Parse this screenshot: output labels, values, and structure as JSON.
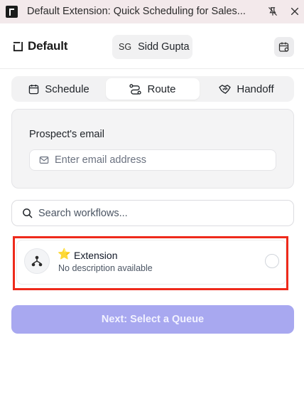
{
  "window": {
    "title": "Default Extension: Quick Scheduling for Sales...",
    "pin_icon": "pin-off-icon",
    "close_icon": "close-icon"
  },
  "header": {
    "brand_name": "Default",
    "brand_icon": "default-logo-icon",
    "user_initials": "SG",
    "user_name": "Sidd Gupta",
    "calendar_icon": "calendar-settings-icon"
  },
  "tabs": [
    {
      "label": "Schedule",
      "icon": "calendar-icon",
      "active": false
    },
    {
      "label": "Route",
      "icon": "route-icon",
      "active": true
    },
    {
      "label": "Handoff",
      "icon": "handshake-icon",
      "active": false
    }
  ],
  "email_card": {
    "label": "Prospect's email",
    "placeholder": "Enter email address",
    "value": ""
  },
  "search": {
    "placeholder": "Search workflows...",
    "value": ""
  },
  "workflows": [
    {
      "title": "Extension",
      "description": "No description available",
      "starred": true,
      "selected": false,
      "icon": "workflow-icon"
    }
  ],
  "next_button": {
    "label": "Next: Select a Queue",
    "disabled": true
  },
  "colors": {
    "accent_disabled": "#a8a8f0",
    "highlight": "#ee2a1b",
    "title_bar": "#f3e9eb"
  }
}
